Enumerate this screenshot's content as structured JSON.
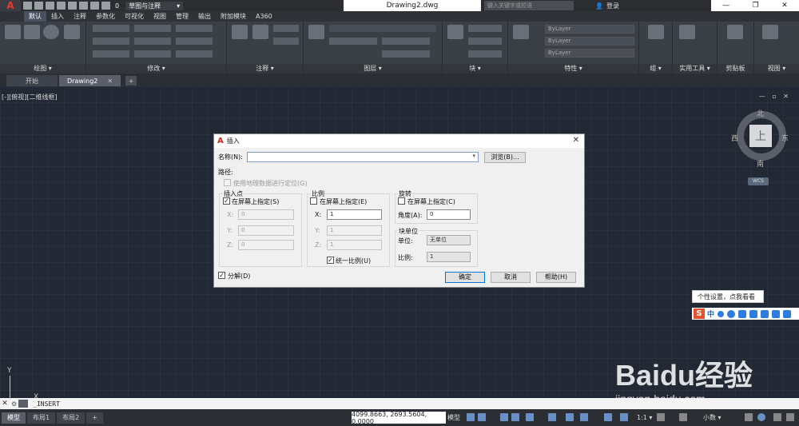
{
  "titlebar": {
    "workspace": "草图与注释",
    "document": "Drawing2.dwg",
    "search_placeholder": "键入关键字或短语",
    "login": "登录",
    "layer_value": "0"
  },
  "ribbon": {
    "tabs": [
      "默认",
      "插入",
      "注释",
      "参数化",
      "可视化",
      "视图",
      "管理",
      "输出",
      "附加模块",
      "A360"
    ],
    "active_tab": 0,
    "panels": [
      "绘图 ▾",
      "修改 ▾",
      "注释 ▾",
      "图层 ▾",
      "块 ▾",
      "特性 ▾",
      "组 ▾",
      "实用工具 ▾",
      "剪贴板",
      "视图 ▾"
    ],
    "bylayer": [
      "ByLayer",
      "ByLayer",
      "ByLayer"
    ]
  },
  "file_tabs": {
    "start": "开始",
    "drawing": "Drawing2",
    "add": "+"
  },
  "viewport": {
    "label": "[-][俯视][二维线框]",
    "controls": "— ▫ ✕"
  },
  "viewcube": {
    "top": "上",
    "north": "北",
    "south": "南",
    "east": "东",
    "west": "西",
    "wcs": "WCS"
  },
  "dialog": {
    "title": "插入",
    "name_label": "名称(N):",
    "browse": "浏览(B)...",
    "path_label": "路径:",
    "geo_checkbox": "使用地理数据进行定位(G)",
    "insert_point": {
      "heading": "插入点",
      "specify": "在屏幕上指定(S)",
      "specify_checked": true,
      "x_label": "X:",
      "x": "0",
      "y_label": "Y:",
      "y": "0",
      "z_label": "Z:",
      "z": "0"
    },
    "scale": {
      "heading": "比例",
      "specify": "在屏幕上指定(E)",
      "specify_checked": false,
      "x_label": "X:",
      "x": "1",
      "y_label": "Y:",
      "y": "1",
      "z_label": "Z:",
      "z": "1",
      "uniform": "统一比例(U)",
      "uniform_checked": true
    },
    "rotation": {
      "heading": "旋转",
      "specify": "在屏幕上指定(C)",
      "specify_checked": false,
      "angle_label": "角度(A):",
      "angle": "0"
    },
    "block_unit": {
      "heading": "块单位",
      "unit_label": "单位:",
      "unit": "无单位",
      "factor_label": "比例:",
      "factor": "1"
    },
    "explode": "分解(D)",
    "explode_checked": true,
    "ok": "确定",
    "cancel": "取消",
    "help": "帮助(H)"
  },
  "ime": {
    "tip": "个性设置，点我看看",
    "logo": "S",
    "mode": "中"
  },
  "ucs": {
    "y": "Y",
    "x": "X"
  },
  "command": {
    "text": "_INSERT"
  },
  "statusbar": {
    "tabs": [
      "模型",
      "布局1",
      "布局2"
    ],
    "add": "+",
    "coords": "4099.8663, 2693.5604, 0.0000",
    "model": "模型",
    "scale": "1:1 ▾",
    "units": "小数 ▾"
  },
  "watermark": {
    "main": "Baidu经验",
    "sub": "jingyan.baidu.com"
  }
}
